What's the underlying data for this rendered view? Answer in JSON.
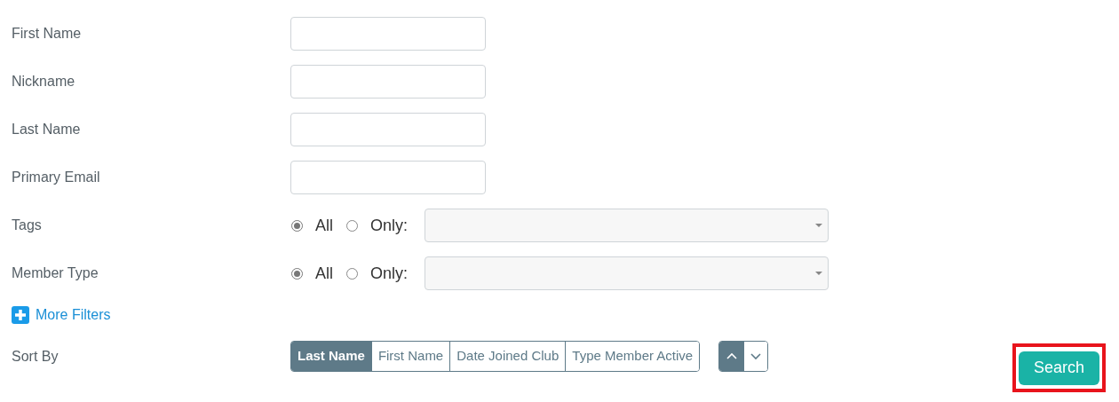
{
  "fields": [
    {
      "label": "First Name",
      "kind": "text"
    },
    {
      "label": "Nickname",
      "kind": "text"
    },
    {
      "label": "Last Name",
      "kind": "text"
    },
    {
      "label": "Primary Email",
      "kind": "text"
    },
    {
      "label": "Tags",
      "kind": "choice",
      "options": [
        {
          "label": "All",
          "selected": true
        },
        {
          "label": "Only:",
          "selected": false
        }
      ]
    },
    {
      "label": "Member Type",
      "kind": "choice",
      "options": [
        {
          "label": "All",
          "selected": true
        },
        {
          "label": "Only:",
          "selected": false
        }
      ]
    }
  ],
  "more_filters": {
    "label": "More Filters"
  },
  "sort": {
    "label": "Sort By",
    "options": [
      {
        "label": "Last Name",
        "selected": true
      },
      {
        "label": "First Name",
        "selected": false
      },
      {
        "label": "Date Joined Club",
        "selected": false
      },
      {
        "label": "Type Member Active",
        "selected": false
      }
    ],
    "directions": [
      {
        "kind": "ascending",
        "selected": true
      },
      {
        "kind": "descending",
        "selected": false
      }
    ]
  },
  "search_button": {
    "label": "Search",
    "highlighted": true
  }
}
